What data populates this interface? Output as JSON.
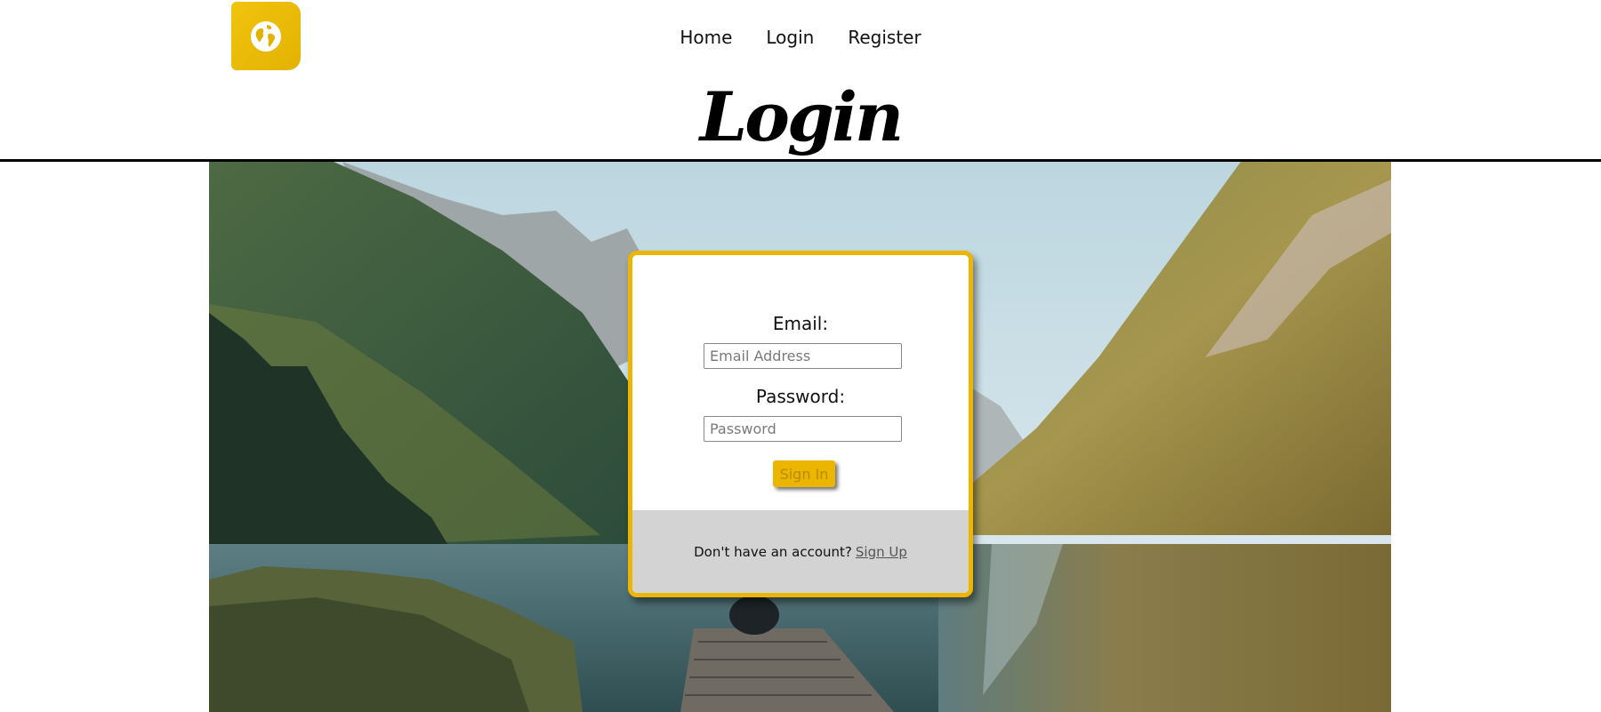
{
  "header": {
    "logo_icon": "globe-icon",
    "nav": [
      {
        "label": "Home"
      },
      {
        "label": "Login"
      },
      {
        "label": "Register"
      }
    ],
    "title": "Login"
  },
  "login_form": {
    "email_label": "Email:",
    "email_placeholder": "Email Address",
    "email_value": "",
    "password_label": "Password:",
    "password_placeholder": "Password",
    "password_value": "",
    "submit_label": "Sign In",
    "footer_text": "Don't have an account?",
    "signup_link": "Sign Up"
  },
  "colors": {
    "accent": "#ecb500",
    "footer_bg": "#d3d3d3"
  }
}
